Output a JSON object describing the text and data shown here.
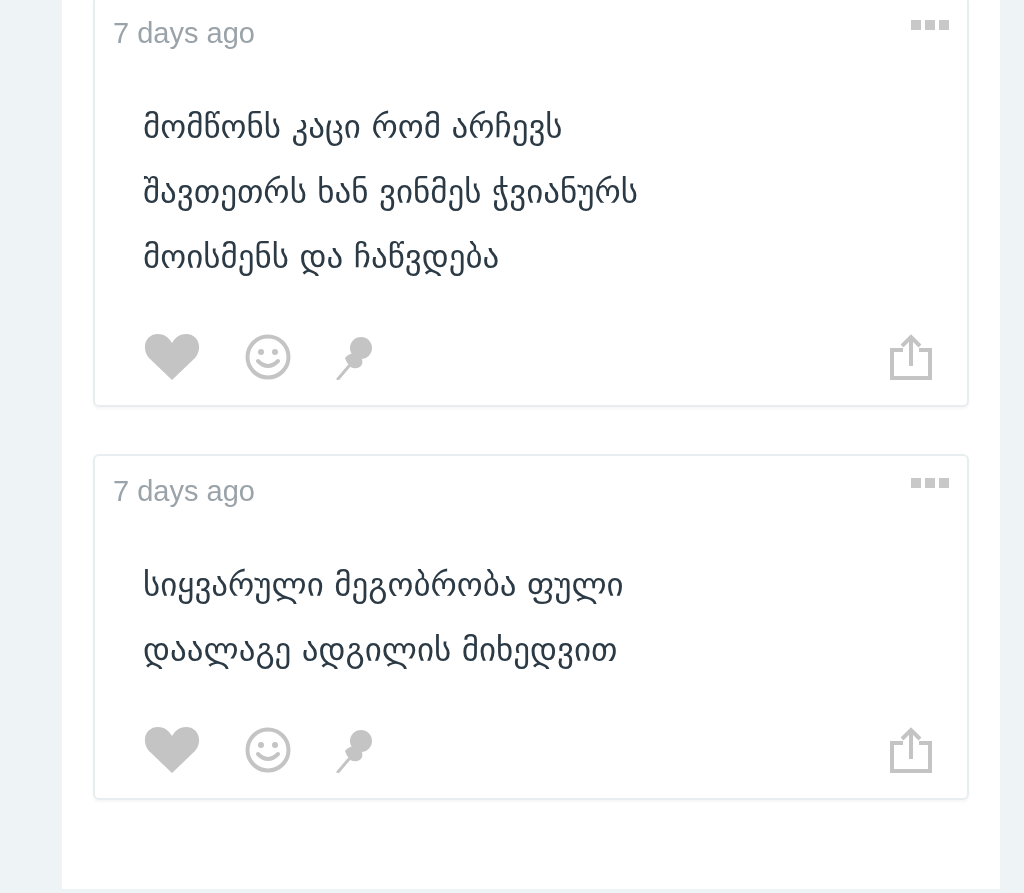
{
  "posts": [
    {
      "time": "7 days ago",
      "text": "მომწონს კაცი რომ არჩევს\nშავთეთრს ხან ვინმეს ჭვიანურს\nმოისმენს და ჩაწვდება"
    },
    {
      "time": "7 days ago",
      "text": "სიყვარული მეგობრობა ფული\nდაალაგე ადგილის მიხედვით"
    }
  ]
}
